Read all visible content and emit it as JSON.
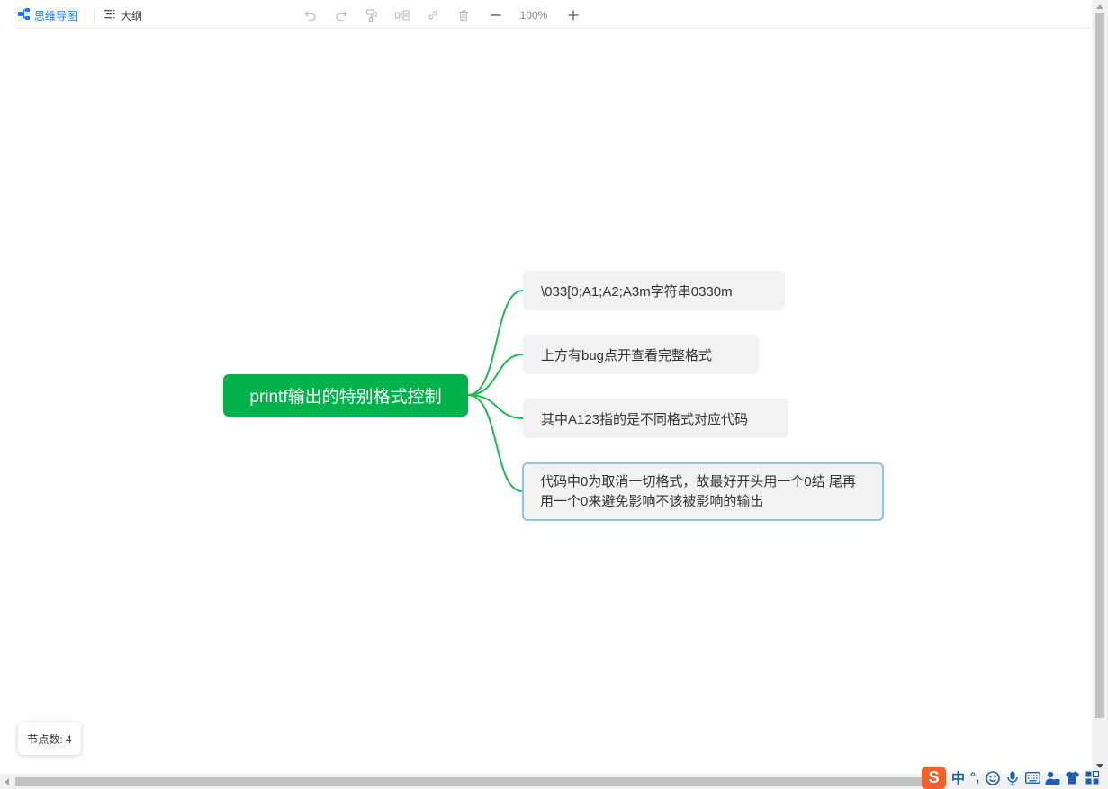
{
  "toolbar": {
    "mindmap_label": "思维导图",
    "outline_label": "大纲",
    "zoom_level": "100%",
    "icons": [
      "mindmap-icon",
      "outline-icon",
      "undo-icon",
      "redo-icon",
      "format-painter-icon",
      "insert-node-icon",
      "link-icon",
      "delete-icon",
      "zoom-out-icon",
      "zoom-in-icon"
    ]
  },
  "mindmap": {
    "root": "printf输出的特别格式控制",
    "children": [
      "\\033[0;A1;A2;A3m字符串0330m",
      "上方有bug点开查看完整格式",
      "其中A123指的是不同格式对应代码",
      "代码中0为取消一切格式，故最好开头用一个0结 尾再用一个0来避免影响不该被影响的输出"
    ],
    "selected_child_index": 3
  },
  "status": {
    "node_count": "节点数: 4"
  },
  "ime": {
    "logo": "S",
    "mode": "中",
    "punct": "°,"
  },
  "colors": {
    "root_bg": "#03b24a",
    "link": "#1db954",
    "node_bg": "#f2f2f2",
    "selected_border": "#8fc6e8",
    "accent": "#1677ff"
  }
}
